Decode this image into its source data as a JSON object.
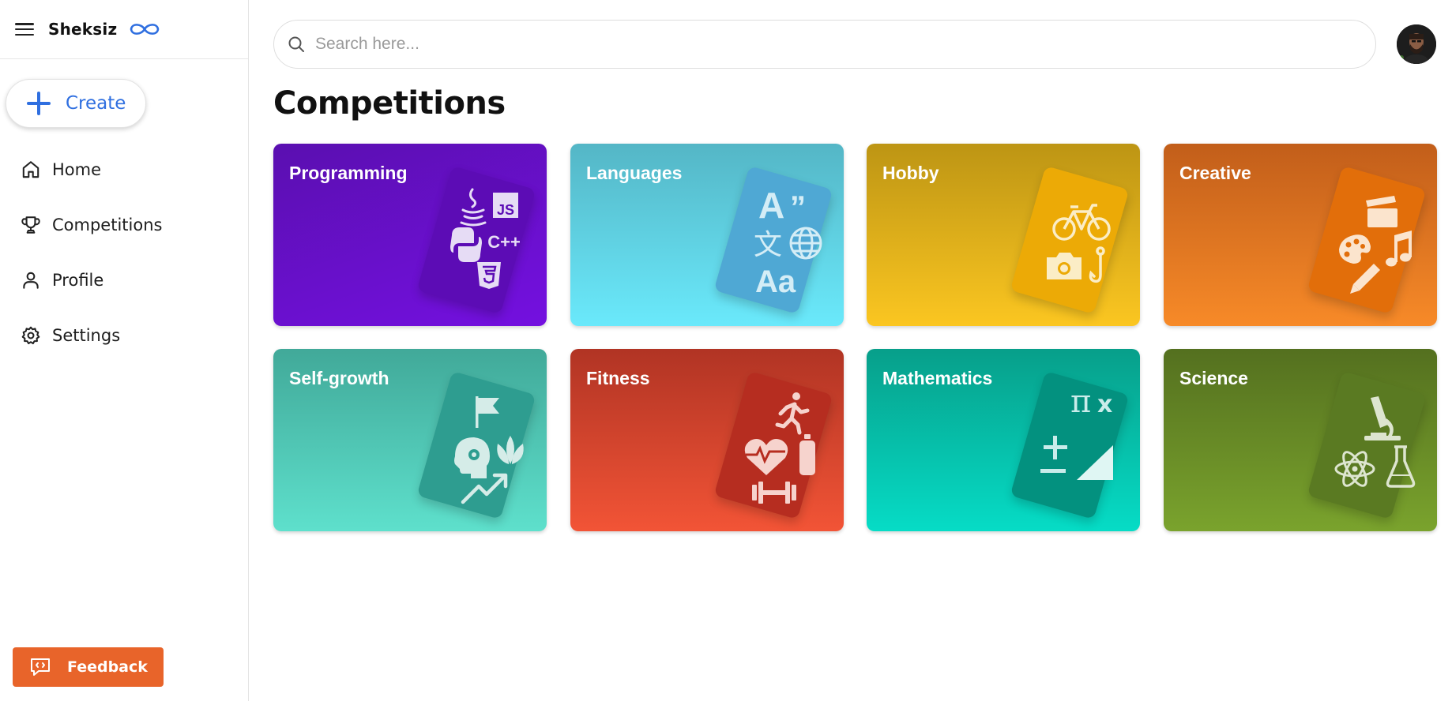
{
  "app": {
    "brand_name": "Sheksiz"
  },
  "sidebar": {
    "create_label": "Create",
    "items": [
      {
        "label": "Home",
        "icon": "home-icon"
      },
      {
        "label": "Competitions",
        "icon": "trophy-icon"
      },
      {
        "label": "Profile",
        "icon": "user-icon"
      },
      {
        "label": "Settings",
        "icon": "gear-icon"
      }
    ],
    "feedback_label": "Feedback"
  },
  "search": {
    "placeholder": "Search here..."
  },
  "main": {
    "title": "Competitions",
    "categories": [
      {
        "label": "Programming",
        "icon_labels": [
          "JS",
          "C++"
        ]
      },
      {
        "label": "Languages",
        "icon_labels": [
          "A",
          "”",
          "文",
          "Aa"
        ]
      },
      {
        "label": "Hobby"
      },
      {
        "label": "Creative"
      },
      {
        "label": "Self-growth"
      },
      {
        "label": "Fitness"
      },
      {
        "label": "Mathematics",
        "icon_labels": [
          "π",
          "x"
        ]
      },
      {
        "label": "Science"
      }
    ]
  },
  "colors": {
    "accent": "#2f6fe0",
    "feedback": "#e8642a"
  }
}
